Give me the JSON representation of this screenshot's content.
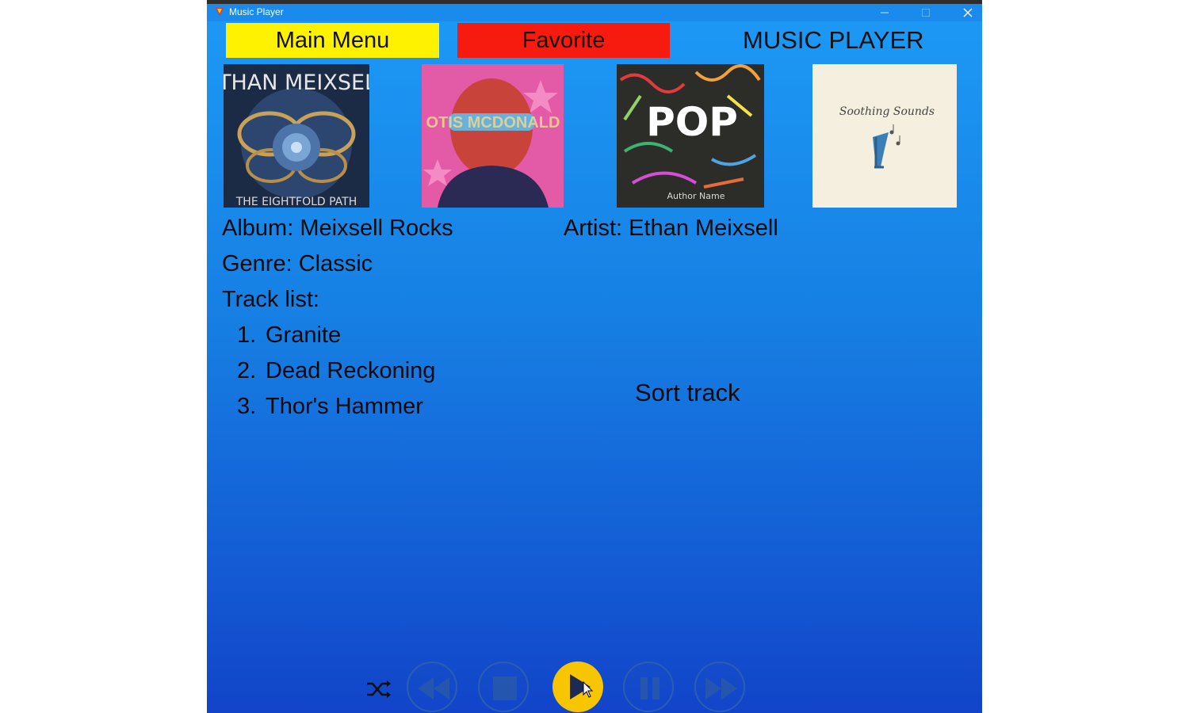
{
  "window": {
    "title": "Music Player",
    "background_top": "#1d9af6",
    "background_bottom": "#1244c9"
  },
  "nav": {
    "main_menu_label": "Main Menu",
    "main_menu_color": "#fff200",
    "favorite_label": "Favorite",
    "favorite_color": "#f71a0f",
    "heading": "MUSIC PLAYER"
  },
  "covers": [
    {
      "icon": "album-art-meixsell",
      "art_text_top": "ETHAN MEIXSELL",
      "art_text_bottom": "THE EIGHTFOLD PATH"
    },
    {
      "icon": "album-art-otis-mcdonald",
      "art_text": "OTIS MCDONALD"
    },
    {
      "icon": "album-art-pop",
      "art_text": "POP",
      "art_text_small": "Author Name"
    },
    {
      "icon": "album-art-soothing-sounds",
      "art_text": "Soothing Sounds"
    }
  ],
  "details": {
    "album": "Album: Meixsell Rocks",
    "artist": "Artist: Ethan Meixsell",
    "genre": "Genre: Classic",
    "track_list_label": "Track list:",
    "tracks": [
      {
        "num": "1.",
        "title": "Granite"
      },
      {
        "num": "2.",
        "title": "Dead Reckoning"
      },
      {
        "num": "3.",
        "title": "Thor's Hammer"
      }
    ],
    "sort_label": "Sort track"
  },
  "controls": {
    "icons": [
      "shuffle-icon",
      "previous-icon",
      "stop-icon",
      "play-icon",
      "pause-icon",
      "next-icon"
    ],
    "play_color": "#f7c600"
  }
}
